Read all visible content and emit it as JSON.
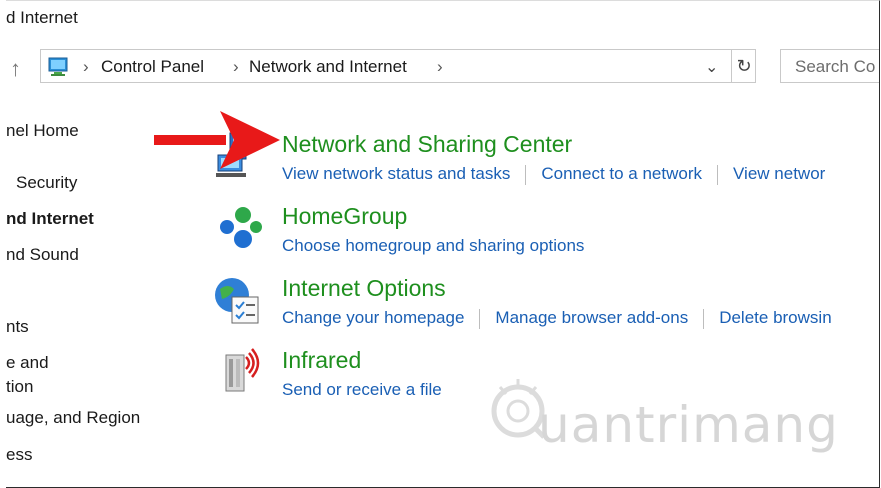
{
  "window": {
    "title": "d Internet"
  },
  "address": {
    "crumbs": [
      "Control Panel",
      "Network and Internet"
    ],
    "separator": "›"
  },
  "search": {
    "placeholder": "Search Co"
  },
  "sidebar": {
    "items": [
      {
        "label": "nel Home",
        "bold": false
      },
      {
        "label": "Security",
        "bold": false
      },
      {
        "label": "nd Internet",
        "bold": true
      },
      {
        "label": "nd Sound",
        "bold": false
      },
      {
        "label": "nts",
        "bold": false
      },
      {
        "label": "e and",
        "bold": false
      },
      {
        "label": "tion",
        "bold": false
      },
      {
        "label": "uage, and Region",
        "bold": false
      },
      {
        "label": "ess",
        "bold": false
      }
    ]
  },
  "categories": [
    {
      "title": "Network and Sharing Center",
      "links": [
        "View network status and tasks",
        "Connect to a network",
        "View networ"
      ]
    },
    {
      "title": "HomeGroup",
      "links": [
        "Choose homegroup and sharing options"
      ]
    },
    {
      "title": "Internet Options",
      "links": [
        "Change your homepage",
        "Manage browser add-ons",
        "Delete browsin"
      ]
    },
    {
      "title": "Infrared",
      "links": [
        "Send or receive a file"
      ]
    }
  ],
  "watermark": {
    "text": "uantrimang"
  },
  "colors": {
    "heading": "#1e8f1e",
    "link": "#1a5fb4",
    "arrow": "#e81919"
  }
}
